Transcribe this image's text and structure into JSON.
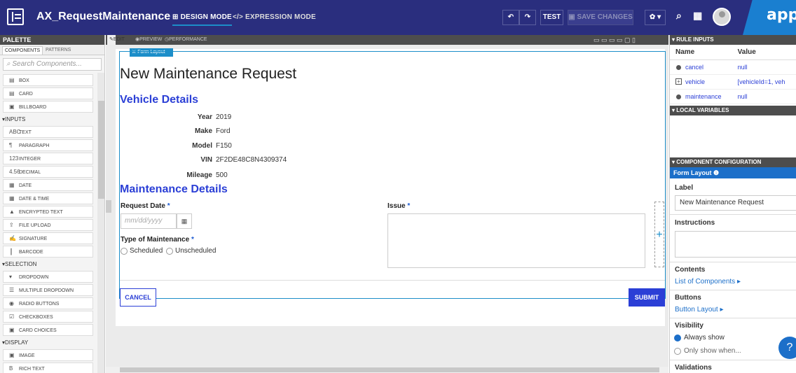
{
  "header": {
    "app_title": "AX_RequestMaintenance",
    "design_mode": "DESIGN MODE",
    "expression_mode": "EXPRESSION MODE",
    "test_label": "TEST",
    "save_label": "SAVE CHANGES",
    "brand": "appia"
  },
  "palette": {
    "title": "PALETTE",
    "tabs": [
      "COMPONENTS",
      "PATTERNS"
    ],
    "search_placeholder": "Search Components...",
    "layout_items": [
      "BOX",
      "CARD",
      "BILLBOARD"
    ],
    "inputs_section": "INPUTS",
    "inputs_items": [
      "TEXT",
      "PARAGRAPH",
      "INTEGER",
      "DECIMAL",
      "DATE",
      "DATE & TIME",
      "ENCRYPTED TEXT",
      "FILE UPLOAD",
      "SIGNATURE",
      "BARCODE"
    ],
    "selection_section": "SELECTION",
    "selection_items": [
      "DROPDOWN",
      "MULTIPLE DROPDOWN",
      "RADIO BUTTONS",
      "CHECKBOXES",
      "CARD CHOICES"
    ],
    "display_section": "DISPLAY",
    "display_items": [
      "IMAGE",
      "RICH TEXT"
    ]
  },
  "editor": {
    "tabs": [
      "EDIT",
      "PREVIEW",
      "PERFORMANCE"
    ],
    "form_layout_tag": "Form Layout",
    "title": "New Maintenance Request",
    "vehicle_section": "Vehicle Details",
    "vehicle": {
      "year_label": "Year",
      "year": "2019",
      "make_label": "Make",
      "make": "Ford",
      "model_label": "Model",
      "model": "F150",
      "vin_label": "VIN",
      "vin": "2F2DE48C8N4309374",
      "mileage_label": "Mileage",
      "mileage": "500"
    },
    "maintenance_section": "Maintenance Details",
    "request_date_label": "Request Date",
    "date_placeholder": "mm/dd/yyyy",
    "type_label": "Type of Maintenance",
    "type_options": [
      "Scheduled",
      "Unscheduled"
    ],
    "issue_label": "Issue",
    "cancel_label": "CANCEL",
    "submit_label": "SUBMIT"
  },
  "rule_inputs": {
    "title": "RULE INPUTS",
    "col_name": "Name",
    "col_value": "Value",
    "rows": [
      {
        "name": "cancel",
        "value": "null"
      },
      {
        "name": "vehicle",
        "value": "[vehicleId=1, veh"
      },
      {
        "name": "maintenance",
        "value": "null"
      }
    ]
  },
  "local_variables": {
    "title": "LOCAL VARIABLES"
  },
  "component_config": {
    "title": "COMPONENT CONFIGURATION",
    "component": "Form Layout",
    "label_label": "Label",
    "label_value": "New Maintenance Request",
    "instructions_label": "Instructions",
    "contents_label": "Contents",
    "contents_link": "List of Components",
    "buttons_label": "Buttons",
    "buttons_link": "Button Layout",
    "visibility_label": "Visibility",
    "visibility_options": [
      "Always show",
      "Only show when..."
    ],
    "validations_label": "Validations"
  },
  "colors": {
    "header": "#2a2e7e",
    "accent": "#1c8ec9",
    "link": "#2b3fd6"
  }
}
